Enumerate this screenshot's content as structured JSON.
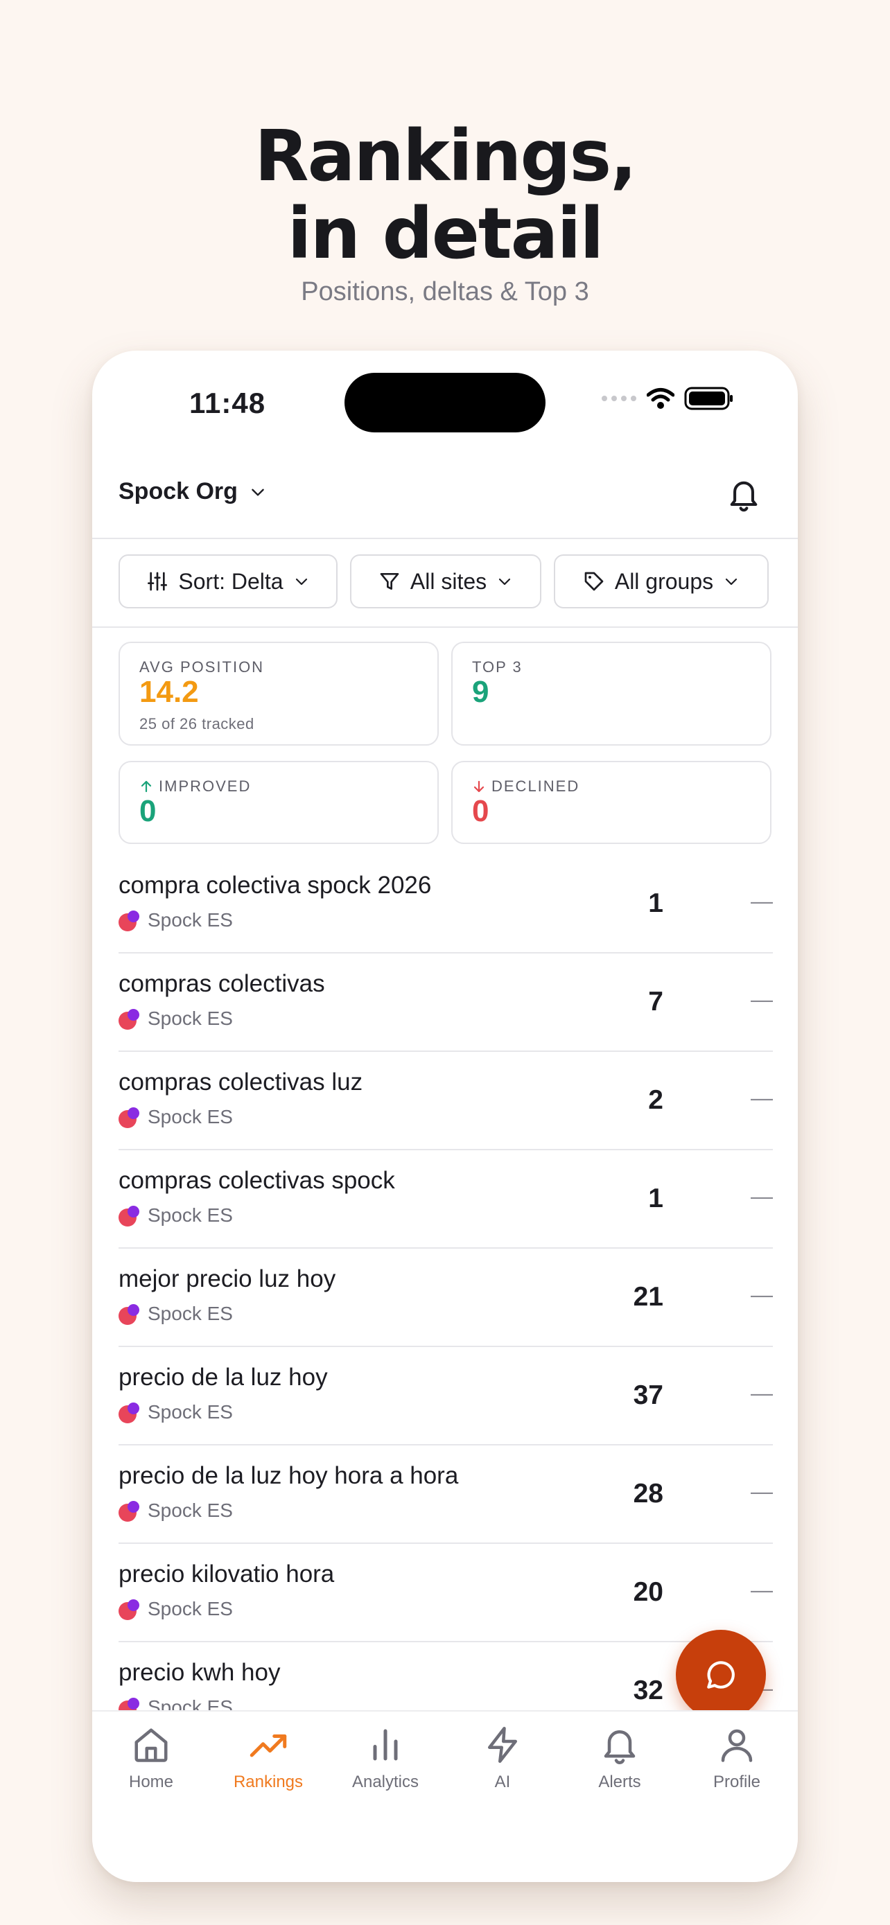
{
  "hero": {
    "title_line1": "Rankings,",
    "title_line2": "in detail",
    "subtitle": "Positions, deltas & Top 3"
  },
  "status_bar": {
    "time": "11:48"
  },
  "header": {
    "org_name": "Spock Org"
  },
  "filters": {
    "sort": "Sort: Delta",
    "sites": "All sites",
    "groups": "All groups"
  },
  "stats": {
    "avg_position": {
      "label": "AVG POSITION",
      "value": "14.2",
      "note": "25 of 26 tracked",
      "color": "#f39a12"
    },
    "top3": {
      "label": "TOP 3",
      "value": "9",
      "color": "#1aa37a"
    },
    "improved": {
      "label": "IMPROVED",
      "value": "0",
      "color": "#1aa37a"
    },
    "declined": {
      "label": "DECLINED",
      "value": "0",
      "color": "#e5484d"
    }
  },
  "rankings": [
    {
      "keyword": "compra colectiva spock 2026",
      "site": "Spock ES",
      "position": "1",
      "delta": "—"
    },
    {
      "keyword": "compras colectivas",
      "site": "Spock ES",
      "position": "7",
      "delta": "—"
    },
    {
      "keyword": "compras colectivas luz",
      "site": "Spock ES",
      "position": "2",
      "delta": "—"
    },
    {
      "keyword": "compras colectivas spock",
      "site": "Spock ES",
      "position": "1",
      "delta": "—"
    },
    {
      "keyword": "mejor precio luz hoy",
      "site": "Spock ES",
      "position": "21",
      "delta": "—"
    },
    {
      "keyword": "precio de la luz hoy",
      "site": "Spock ES",
      "position": "37",
      "delta": "—"
    },
    {
      "keyword": "precio de la luz hoy hora a hora",
      "site": "Spock ES",
      "position": "28",
      "delta": "—"
    },
    {
      "keyword": "precio kilovatio hora",
      "site": "Spock ES",
      "position": "20",
      "delta": "—"
    },
    {
      "keyword": "precio kwh hoy",
      "site": "Spock ES",
      "position": "32",
      "delta": "—"
    }
  ],
  "tabs": [
    {
      "label": "Home",
      "icon": "home-icon"
    },
    {
      "label": "Rankings",
      "icon": "trending-up-icon",
      "active": true
    },
    {
      "label": "Analytics",
      "icon": "bar-chart-icon"
    },
    {
      "label": "AI",
      "icon": "lightning-icon"
    },
    {
      "label": "Alerts",
      "icon": "bell-icon"
    },
    {
      "label": "Profile",
      "icon": "user-icon"
    }
  ],
  "colors": {
    "accent": "#f07a1f",
    "fab": "#c73f0c",
    "background": "#fdf6f1"
  }
}
